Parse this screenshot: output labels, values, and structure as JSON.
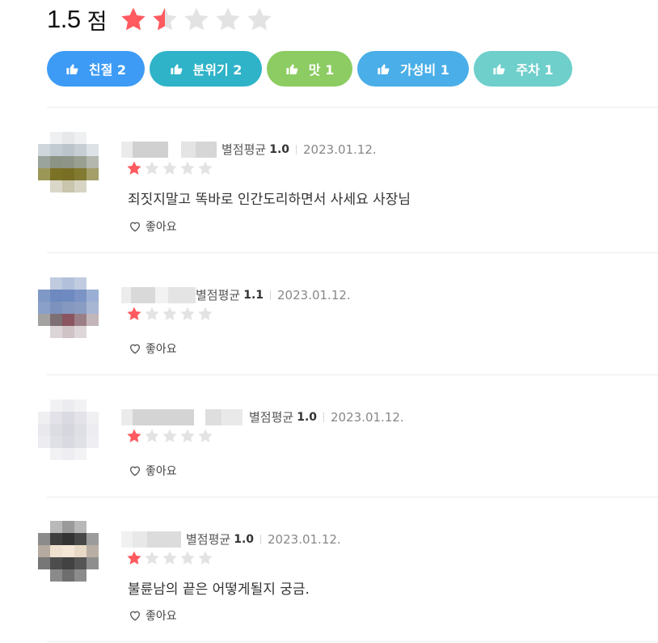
{
  "summary": {
    "score": "1.5",
    "unit": "점",
    "rating_value": 1.5,
    "rating_max": 5,
    "star_color": "#ff5a5f",
    "empty_star_color": "#e3e3e3"
  },
  "keywords": [
    {
      "label": "친절 2",
      "color": "#3d9bf5"
    },
    {
      "label": "분위기 2",
      "color": "#2fb3c9"
    },
    {
      "label": "맛 1",
      "color": "#8ccc62"
    },
    {
      "label": "가성비 1",
      "color": "#4aaee8"
    },
    {
      "label": "주차 1",
      "color": "#6ecfcb"
    }
  ],
  "reviews": [
    {
      "avg_label": "별점평균",
      "avg_value": "1.0",
      "date": "2023.01.12.",
      "rating": 1,
      "text": "죄짓지말고 똑바로 인간도리하면서 사세요 사장님",
      "like_label": "좋아요"
    },
    {
      "avg_label": "별점평균",
      "avg_value": "1.1",
      "date": "2023.01.12.",
      "rating": 1,
      "text": "",
      "like_label": "좋아요"
    },
    {
      "avg_label": "별점평균",
      "avg_value": "1.0",
      "date": "2023.01.12.",
      "rating": 1,
      "text": "",
      "like_label": "좋아요"
    },
    {
      "avg_label": "별점평균",
      "avg_value": "1.0",
      "date": "2023.01.12.",
      "rating": 1,
      "text": "불륜남의 끝은 어떻게될지 궁금.",
      "like_label": "좋아요"
    }
  ],
  "icons": {
    "star": "star-icon",
    "thumbs_up": "thumbs-up-icon",
    "heart": "heart-outline-icon"
  }
}
